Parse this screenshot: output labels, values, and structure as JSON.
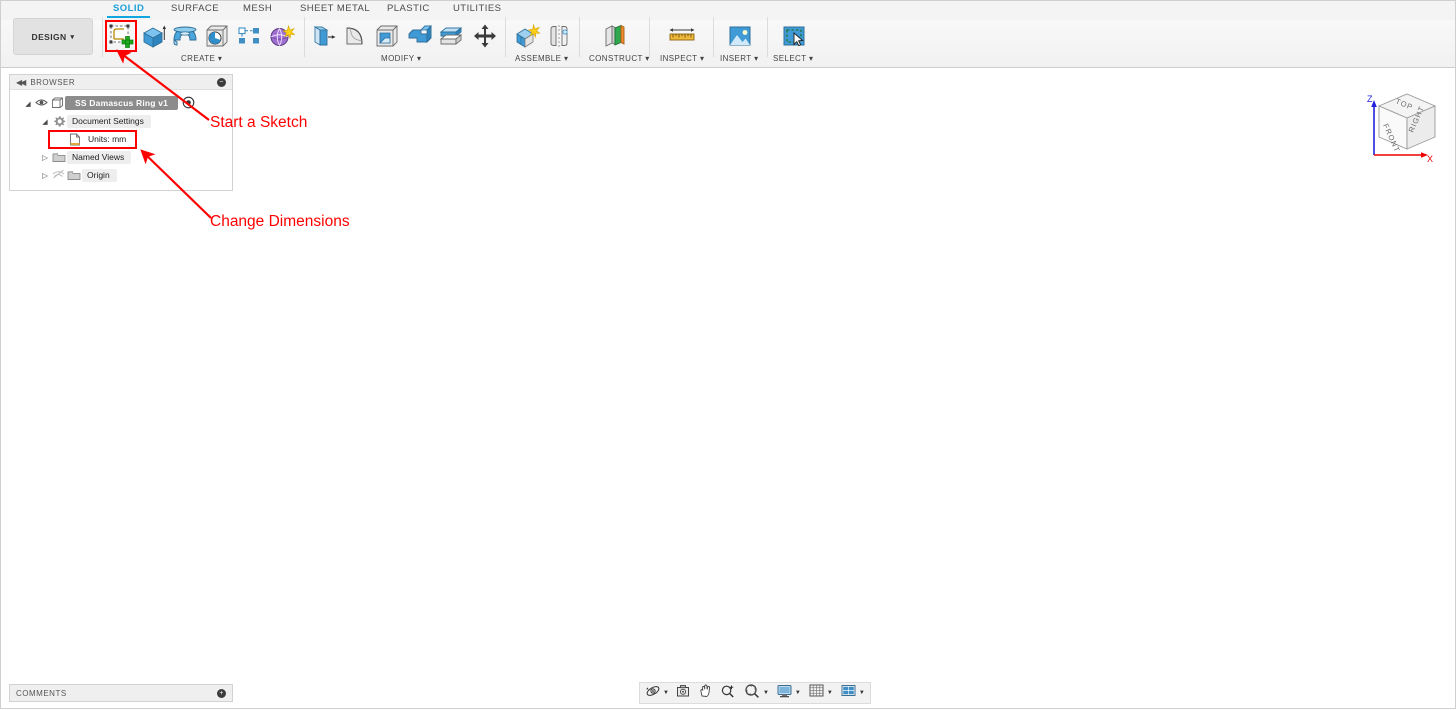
{
  "app": {
    "workspace_button": "DESIGN",
    "tabs": [
      {
        "label": "SOLID",
        "active": true
      },
      {
        "label": "SURFACE",
        "active": false
      },
      {
        "label": "MESH",
        "active": false
      },
      {
        "label": "SHEET METAL",
        "active": false
      },
      {
        "label": "PLASTIC",
        "active": false
      },
      {
        "label": "UTILITIES",
        "active": false
      }
    ]
  },
  "toolbar": {
    "groups": [
      {
        "label": "CREATE ▾",
        "name": "create-group"
      },
      {
        "label": "MODIFY ▾",
        "name": "modify-group"
      },
      {
        "label": "ASSEMBLE ▾",
        "name": "assemble-group"
      },
      {
        "label": "CONSTRUCT ▾",
        "name": "construct-group"
      },
      {
        "label": "INSPECT ▾",
        "name": "inspect-group"
      },
      {
        "label": "INSERT ▾",
        "name": "insert-group"
      },
      {
        "label": "SELECT ▾",
        "name": "select-group"
      }
    ],
    "tools": [
      {
        "name": "create-sketch-icon",
        "title": "Create Sketch"
      },
      {
        "name": "extrude-icon",
        "title": "Extrude"
      },
      {
        "name": "revolve-icon",
        "title": "Revolve"
      },
      {
        "name": "hole-icon",
        "title": "Hole"
      },
      {
        "name": "pattern-icon",
        "title": "Rectangular Pattern"
      },
      {
        "name": "create-form-icon",
        "title": "Create Form"
      },
      {
        "name": "press-pull-icon",
        "title": "Press Pull"
      },
      {
        "name": "fillet-icon",
        "title": "Fillet"
      },
      {
        "name": "shell-icon",
        "title": "Shell"
      },
      {
        "name": "combine-icon",
        "title": "Combine"
      },
      {
        "name": "split-face-icon",
        "title": "Split Face"
      },
      {
        "name": "move-copy-icon",
        "title": "Move/Copy"
      },
      {
        "name": "new-component-icon",
        "title": "New Component"
      },
      {
        "name": "joint-icon",
        "title": "Joint"
      },
      {
        "name": "offset-plane-icon",
        "title": "Offset Plane"
      },
      {
        "name": "measure-icon",
        "title": "Measure"
      },
      {
        "name": "insert-mcmaster-icon",
        "title": "Insert"
      },
      {
        "name": "select-icon",
        "title": "Select"
      }
    ]
  },
  "browser": {
    "title": "BROWSER",
    "collapse_icon": "collapse-left-icon",
    "panel_toggle_icon": "minus-circle-icon",
    "tree": [
      {
        "name": "root-node",
        "expander": "filled",
        "visibility_icon": "eye-icon",
        "node_icon": "component-icon",
        "label": "SS Damascus Ring v1",
        "selected": true,
        "trailing_icon": "target-icon",
        "indent": 0
      },
      {
        "name": "document-settings-node",
        "expander": "filled",
        "node_icon": "gear-icon",
        "label": "Document Settings",
        "selected": false,
        "indent": 1
      },
      {
        "name": "units-node",
        "expander": "none",
        "node_icon": "document-icon",
        "label": "Units: mm",
        "selected": false,
        "indent": 2
      },
      {
        "name": "named-views-node",
        "expander": "hollow",
        "node_icon": "folder-icon",
        "label": "Named Views",
        "selected": false,
        "indent": 1
      },
      {
        "name": "origin-node",
        "expander": "hollow",
        "visibility_icon": "eye-off-icon",
        "node_icon": "folder-icon",
        "label": "Origin",
        "selected": false,
        "indent": 1
      }
    ]
  },
  "comments": {
    "title": "COMMENTS",
    "panel_toggle_icon": "plus-circle-icon"
  },
  "navbar": {
    "items": [
      {
        "name": "orbit-icon",
        "has_caret": true
      },
      {
        "name": "look-at-icon",
        "has_caret": false
      },
      {
        "name": "pan-icon",
        "has_caret": false
      },
      {
        "name": "zoom-icon",
        "has_caret": false
      },
      {
        "name": "zoom-window-icon",
        "has_caret": true
      },
      {
        "name": "display-settings-icon",
        "has_caret": true
      },
      {
        "name": "grid-snap-icon",
        "has_caret": true
      },
      {
        "name": "viewports-icon",
        "has_caret": true
      }
    ]
  },
  "viewcube": {
    "faces": {
      "top": "TOP",
      "front": "FRONT",
      "right": "RIGHT"
    },
    "axes": {
      "z": "Z",
      "x": "X"
    },
    "colors": {
      "z_axis": "#2222dd",
      "x_axis": "#ee0000"
    }
  },
  "annotations": {
    "color": "#fe0000",
    "callouts": [
      {
        "name": "start-a-sketch-callout",
        "text": "Start a Sketch"
      },
      {
        "name": "change-dimensions-callout",
        "text": "Change Dimensions"
      }
    ]
  },
  "colors": {
    "accent_tab": "#12a6e0",
    "annotation_red": "#fe0000",
    "selection_gray": "#8c8c8c",
    "canvas": "#ffffff"
  }
}
